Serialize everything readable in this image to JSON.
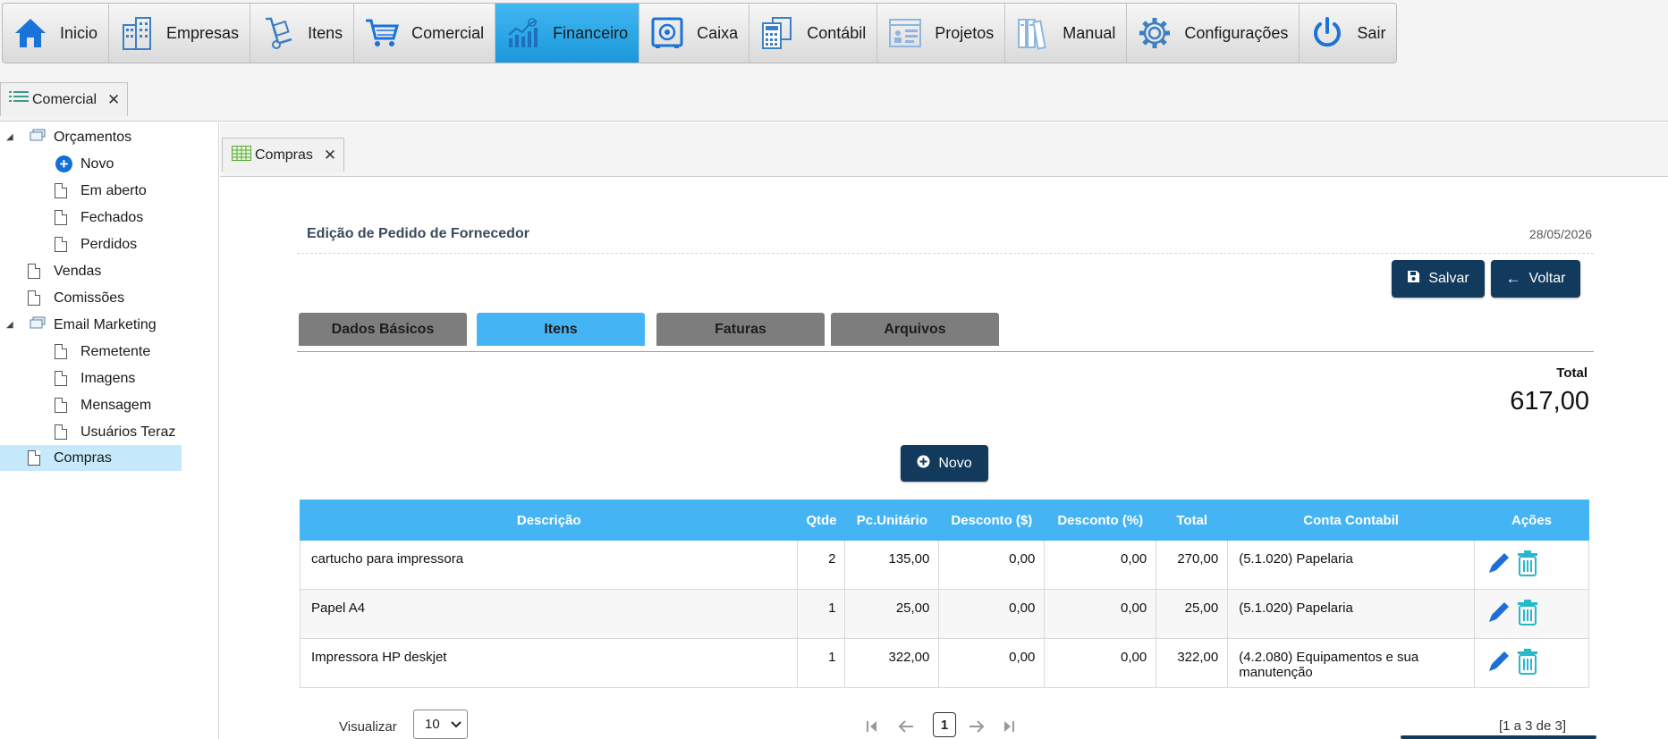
{
  "menu": {
    "items": [
      {
        "label": "Inicio",
        "icon": "home-icon"
      },
      {
        "label": "Empresas",
        "icon": "buildings-icon"
      },
      {
        "label": "Itens",
        "icon": "hand-truck-icon"
      },
      {
        "label": "Comercial",
        "icon": "shopping-cart-icon"
      },
      {
        "label": "Financeiro",
        "icon": "chart-icon"
      },
      {
        "label": "Caixa",
        "icon": "safe-icon"
      },
      {
        "label": "Contábil",
        "icon": "calculator-icon"
      },
      {
        "label": "Projetos",
        "icon": "projects-icon"
      },
      {
        "label": "Manual",
        "icon": "books-icon"
      },
      {
        "label": "Configurações",
        "icon": "gear-icon"
      },
      {
        "label": "Sair",
        "icon": "power-icon"
      }
    ],
    "active": "Financeiro",
    "active_color": "#2aa6e6"
  },
  "outer_tab": {
    "label": "Comercial",
    "close": "✕"
  },
  "sidebar": {
    "orcamentos": "Orçamentos",
    "novo": "Novo",
    "em_aberto": "Em aberto",
    "fechados": "Fechados",
    "perdidos": "Perdidos",
    "vendas": "Vendas",
    "comissoes": "Comissões",
    "email_marketing": "Email Marketing",
    "remetente": "Remetente",
    "imagens": "Imagens",
    "mensagem": "Mensagem",
    "usuarios_teraz": "Usuários Teraz",
    "compras": "Compras",
    "selected_color": "#c6e9fb"
  },
  "inner_tab": {
    "label": "Compras",
    "close": "✕"
  },
  "form": {
    "title": "Edição de Pedido de Fornecedor",
    "date": "28/05/2026",
    "save_label": "Salvar",
    "back_label": "Voltar",
    "tabs": [
      "Dados Básicos",
      "Itens",
      "Faturas",
      "Arquivos"
    ],
    "active_tab": "Itens",
    "total_label": "Total",
    "total_value": "617,00",
    "new_label": "Novo"
  },
  "table": {
    "headers": [
      "Descrição",
      "Qtde",
      "Pc.Unitário",
      "Desconto ($)",
      "Desconto (%)",
      "Total",
      "Conta Contabil",
      "Ações"
    ],
    "rows": [
      {
        "descricao": "cartucho para impressora",
        "qtde": "2",
        "unitario": "135,00",
        "desc_valor": "0,00",
        "desc_pct": "0,00",
        "total": "270,00",
        "conta": "(5.1.020) Papelaria"
      },
      {
        "descricao": "Papel A4",
        "qtde": "1",
        "unitario": "25,00",
        "desc_valor": "0,00",
        "desc_pct": "0,00",
        "total": "25,00",
        "conta": "(5.1.020) Papelaria"
      },
      {
        "descricao": "Impressora HP deskjet",
        "qtde": "1",
        "unitario": "322,00",
        "desc_valor": "0,00",
        "desc_pct": "0,00",
        "total": "322,00",
        "conta": "(4.2.080) Equipamentos e sua manutenção"
      }
    ],
    "header_color": "#45b4f4"
  },
  "pager": {
    "view_label": "Visualizar",
    "page_size": "10",
    "current_page": "1",
    "info": "[1 a 3 de 3]"
  }
}
